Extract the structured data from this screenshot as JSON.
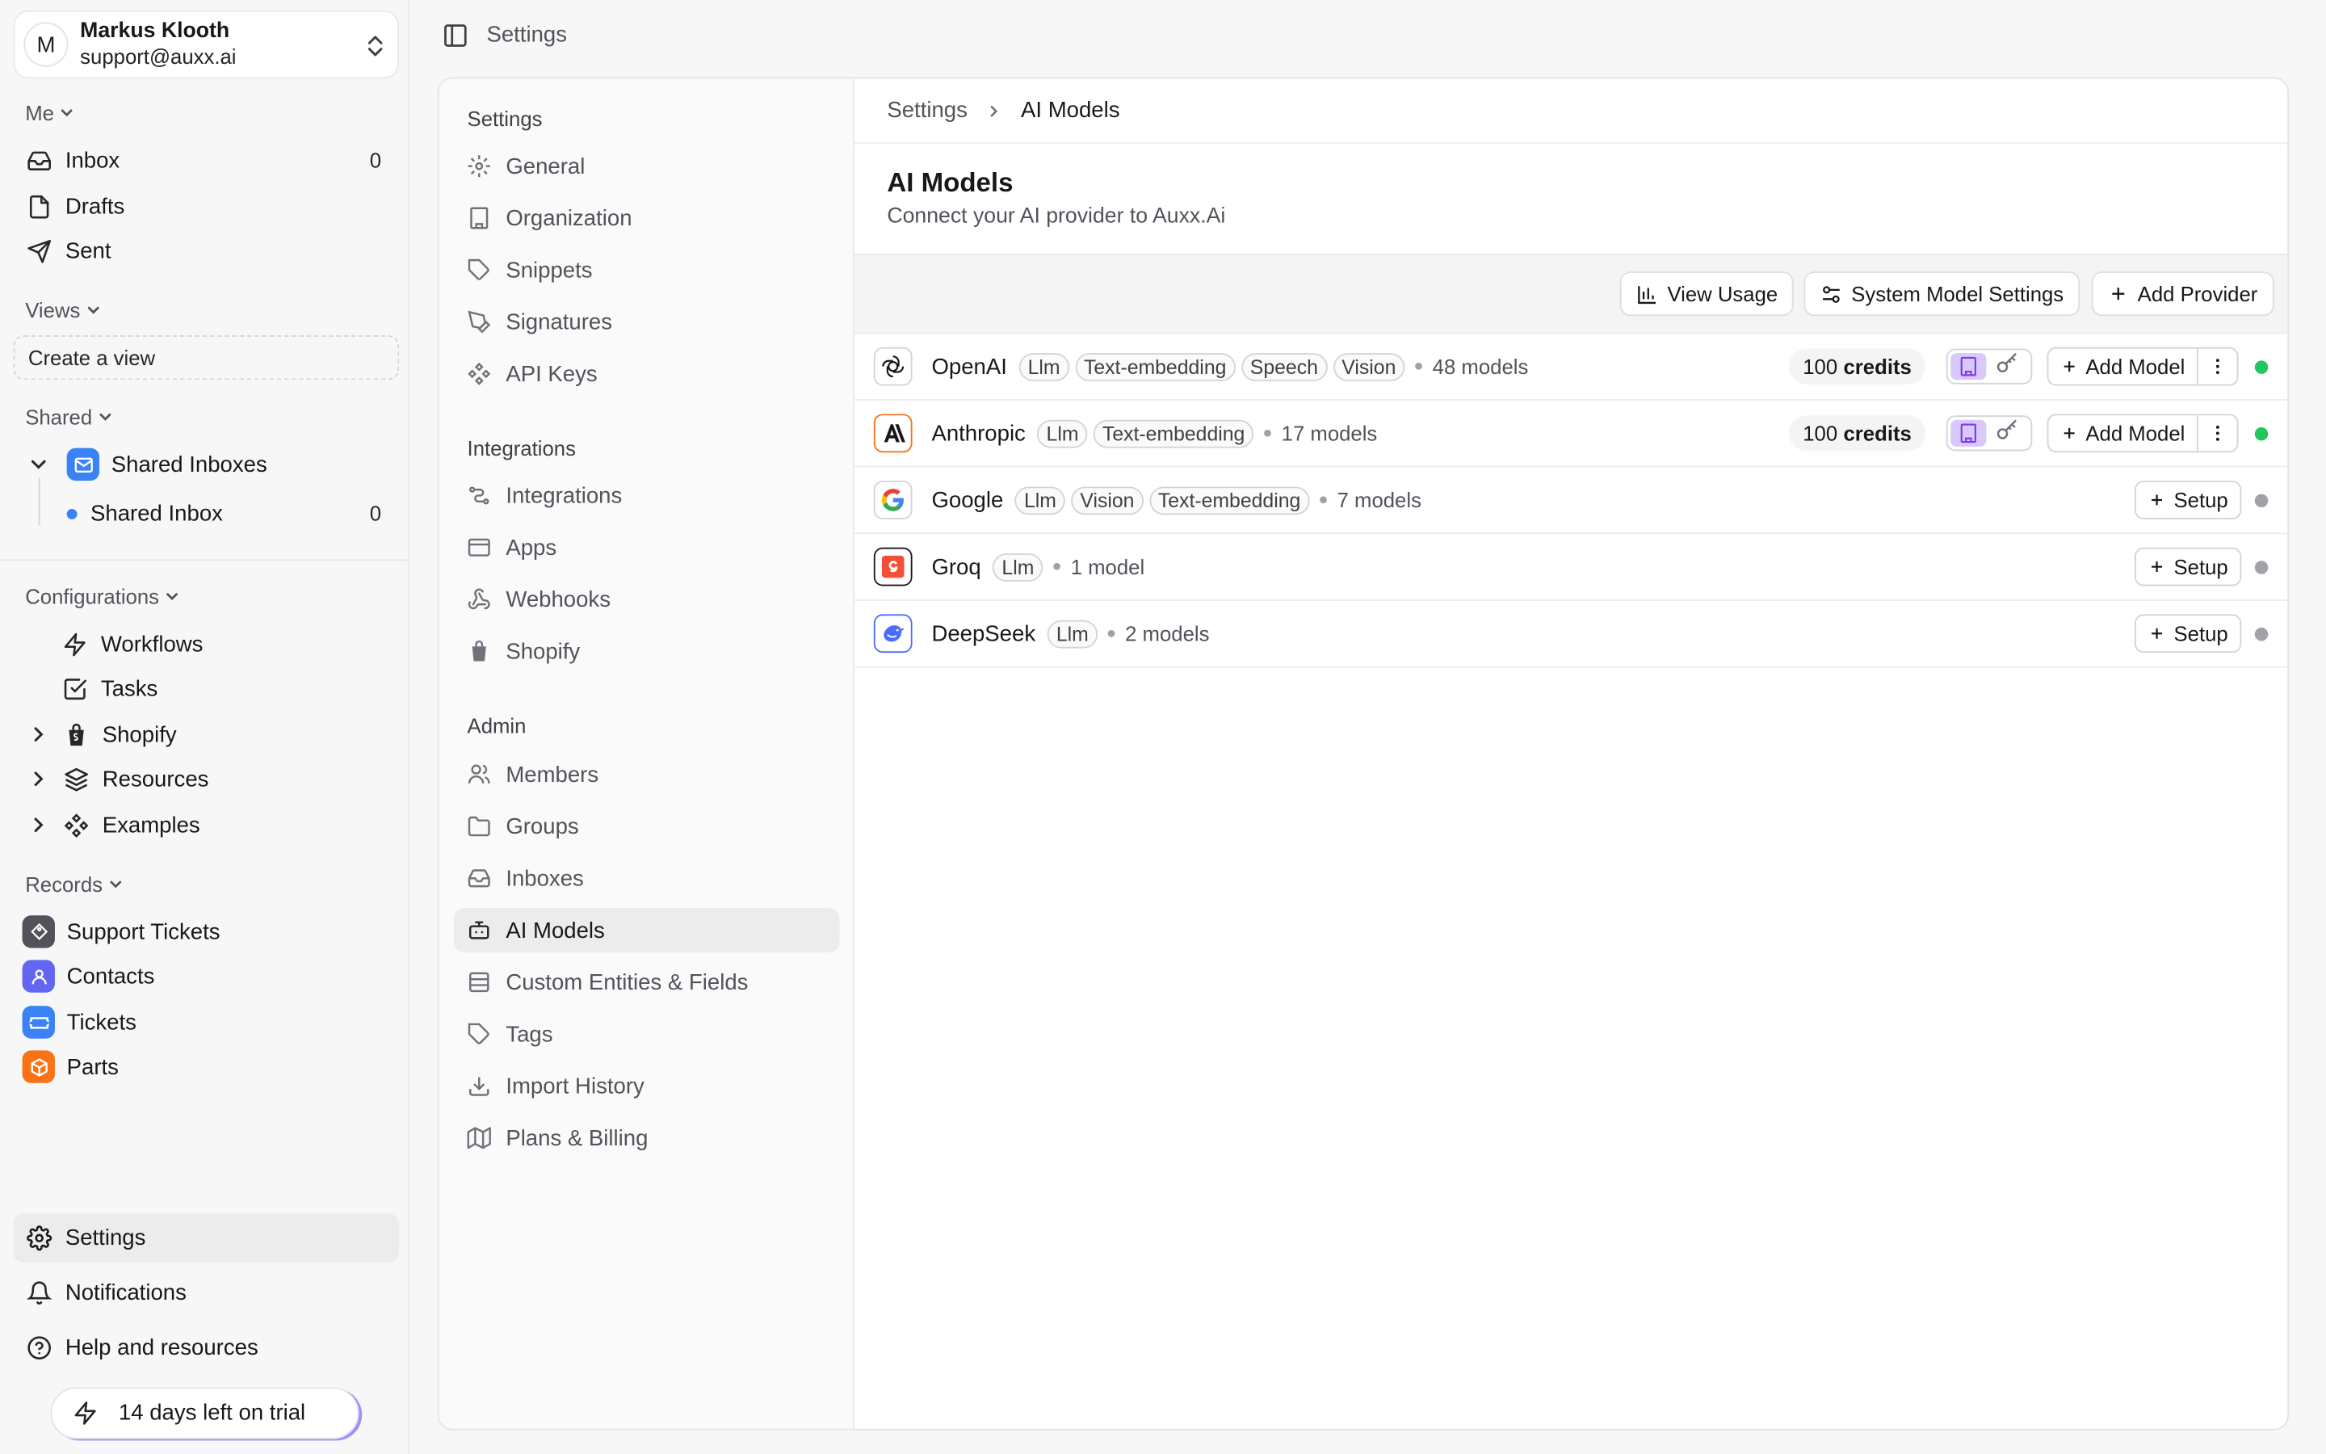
{
  "user": {
    "initial": "M",
    "name": "Markus Klooth",
    "email": "support@auxx.ai"
  },
  "sidebar": {
    "me_label": "Me",
    "me_items": [
      {
        "label": "Inbox",
        "count": "0",
        "icon": "inbox-icon"
      },
      {
        "label": "Drafts",
        "count": "",
        "icon": "file-icon"
      },
      {
        "label": "Sent",
        "count": "",
        "icon": "send-icon"
      }
    ],
    "views_label": "Views",
    "create_view": "Create a view",
    "shared_label": "Shared",
    "shared_inboxes": "Shared Inboxes",
    "shared_inbox": {
      "label": "Shared Inbox",
      "count": "0"
    },
    "configurations_label": "Configurations",
    "config_items": [
      "Workflows",
      "Tasks",
      "Shopify",
      "Resources",
      "Examples"
    ],
    "records_label": "Records",
    "records": [
      {
        "label": "Support Tickets",
        "color": "#52525b"
      },
      {
        "label": "Contacts",
        "color": "#6366f1"
      },
      {
        "label": "Tickets",
        "color": "#3b82f6"
      },
      {
        "label": "Parts",
        "color": "#f97316"
      }
    ],
    "bottom": [
      "Settings",
      "Notifications",
      "Help and resources"
    ],
    "trial": "14 days left on trial"
  },
  "topbar": {
    "title": "Settings"
  },
  "settings_nav": {
    "settings_head": "Settings",
    "settings_items": [
      "General",
      "Organization",
      "Snippets",
      "Signatures",
      "API Keys"
    ],
    "integrations_head": "Integrations",
    "integrations_items": [
      "Integrations",
      "Apps",
      "Webhooks",
      "Shopify"
    ],
    "admin_head": "Admin",
    "admin_items": [
      "Members",
      "Groups",
      "Inboxes",
      "AI Models",
      "Custom Entities & Fields",
      "Tags",
      "Import History",
      "Plans & Billing"
    ]
  },
  "breadcrumb": {
    "root": "Settings",
    "current": "AI Models"
  },
  "page": {
    "title": "AI Models",
    "subtitle": "Connect your AI provider to Auxx.Ai"
  },
  "toolbar": {
    "view_usage": "View Usage",
    "system_settings": "System Model Settings",
    "add_provider": "Add Provider"
  },
  "providers": [
    {
      "name": "OpenAI",
      "tags": [
        "Llm",
        "Text-embedding",
        "Speech",
        "Vision"
      ],
      "models": "48 models",
      "credits_num": "100",
      "credits_word": "credits",
      "action": "Add Model",
      "status_color": "#22c55e"
    },
    {
      "name": "Anthropic",
      "tags": [
        "Llm",
        "Text-embedding"
      ],
      "models": "17 models",
      "credits_num": "100",
      "credits_word": "credits",
      "action": "Add Model",
      "status_color": "#22c55e"
    },
    {
      "name": "Google",
      "tags": [
        "Llm",
        "Vision",
        "Text-embedding"
      ],
      "models": "7 models",
      "action": "Setup",
      "status_color": "#a1a1aa"
    },
    {
      "name": "Groq",
      "tags": [
        "Llm"
      ],
      "models": "1 model",
      "action": "Setup",
      "status_color": "#a1a1aa"
    },
    {
      "name": "DeepSeek",
      "tags": [
        "Llm"
      ],
      "models": "2 models",
      "action": "Setup",
      "status_color": "#a1a1aa"
    }
  ]
}
